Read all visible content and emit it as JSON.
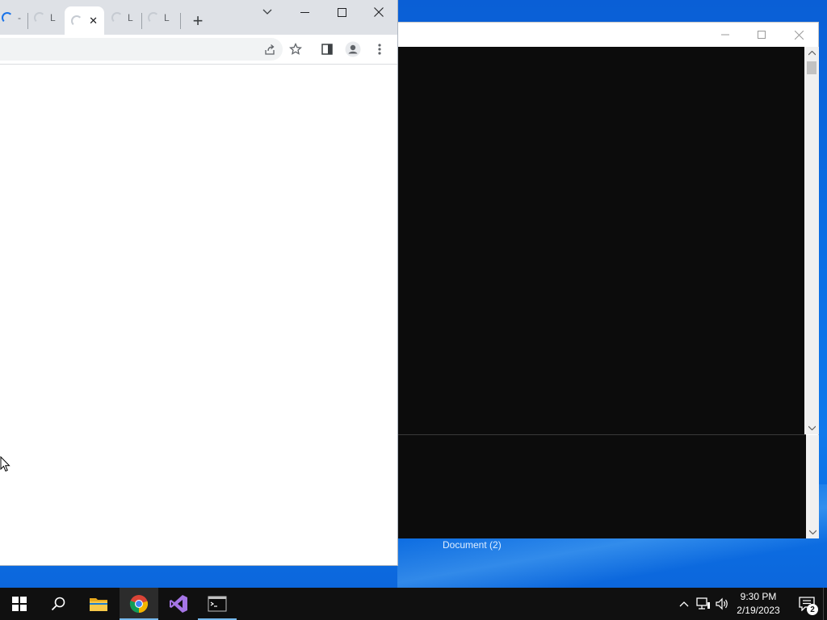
{
  "chrome": {
    "tabs": [
      {
        "label": "-",
        "state": "loading"
      },
      {
        "label": "L",
        "state": "loading"
      },
      {
        "label": "",
        "state": "active-loading",
        "close": "✕"
      },
      {
        "label": "L",
        "state": "loading"
      },
      {
        "label": "L",
        "state": "loading"
      }
    ],
    "new_tab": "+",
    "toolbar_icons": [
      "share-icon",
      "star-icon",
      "side-panel-icon",
      "profile-icon",
      "menu-icon"
    ]
  },
  "console": {
    "title": ""
  },
  "desktop": {
    "taskbar_label": "Document (2)"
  },
  "taskbar": {
    "apps": [
      "start-icon",
      "search-icon",
      "file-explorer-icon",
      "chrome-icon",
      "visual-studio-icon",
      "terminal-icon"
    ],
    "time": "9:30 PM",
    "date": "2/19/2023",
    "notification_count": "2"
  },
  "colors": {
    "desktop": "#0b70e6",
    "taskbar": "#101010",
    "console_bg": "#0c0c0c",
    "chrome_tabstrip": "#dee1e6",
    "accent": "#1a73e8"
  }
}
